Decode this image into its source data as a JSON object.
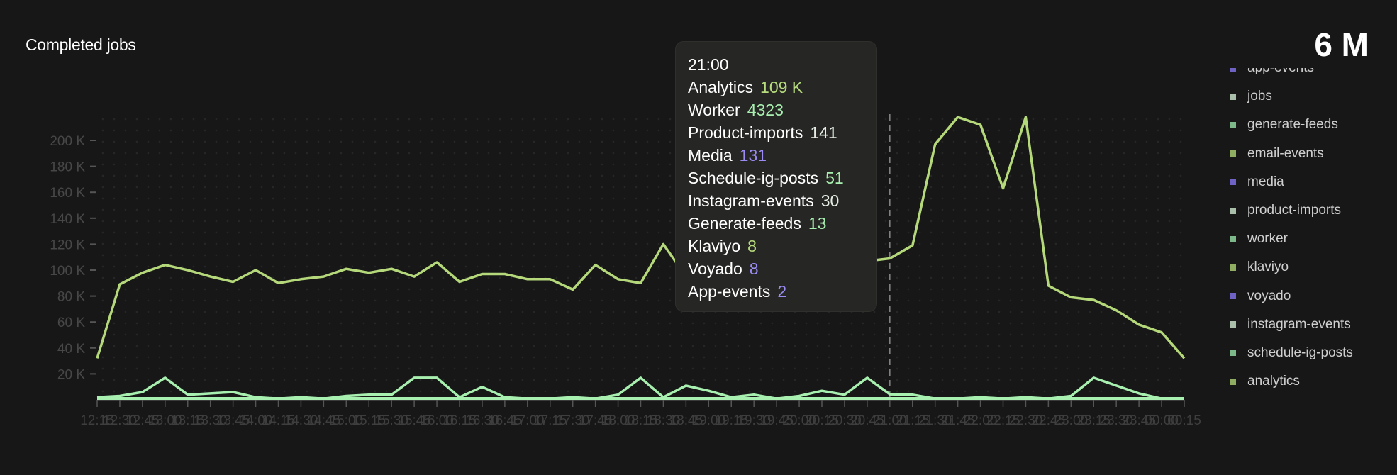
{
  "header": {
    "title": "Completed jobs",
    "total": "6 M"
  },
  "legend": [
    {
      "label": "app-events",
      "color": "#6e63c4"
    },
    {
      "label": "jobs",
      "color": "#a9bfa9"
    },
    {
      "label": "generate-feeds",
      "color": "#7db88a"
    },
    {
      "label": "email-events",
      "color": "#8fae62"
    },
    {
      "label": "media",
      "color": "#6e63c4"
    },
    {
      "label": "product-imports",
      "color": "#a9bfa9"
    },
    {
      "label": "worker",
      "color": "#7db88a"
    },
    {
      "label": "klaviyo",
      "color": "#8fae62"
    },
    {
      "label": "voyado",
      "color": "#6e63c4"
    },
    {
      "label": "instagram-events",
      "color": "#a9bfa9"
    },
    {
      "label": "schedule-ig-posts",
      "color": "#7db88a"
    },
    {
      "label": "analytics",
      "color": "#8fae62"
    }
  ],
  "tooltip": {
    "time": "21:00",
    "rows": [
      {
        "label": "Analytics",
        "value": "109 K",
        "color": "#b7dc7d"
      },
      {
        "label": "Worker",
        "value": "4323",
        "color": "#a8f0b0"
      },
      {
        "label": "Product-imports",
        "value": "141",
        "color": "#e6eee6"
      },
      {
        "label": "Media",
        "value": "131",
        "color": "#9a8cf2"
      },
      {
        "label": "Schedule-ig-posts",
        "value": "51",
        "color": "#a8f0b0"
      },
      {
        "label": "Instagram-events",
        "value": "30",
        "color": "#e6eee6"
      },
      {
        "label": "Generate-feeds",
        "value": "13",
        "color": "#a8f0b0"
      },
      {
        "label": "Klaviyo",
        "value": "8",
        "color": "#b7dc7d"
      },
      {
        "label": "Voyado",
        "value": "8",
        "color": "#9a8cf2"
      },
      {
        "label": "App-events",
        "value": "2",
        "color": "#9a8cf2"
      }
    ]
  },
  "chart_data": {
    "type": "line",
    "title": "Completed jobs",
    "ylim": [
      0,
      200000
    ],
    "yticks": [
      20000,
      40000,
      60000,
      80000,
      100000,
      120000,
      140000,
      160000,
      180000,
      200000
    ],
    "ytick_labels": [
      "20 K",
      "40 K",
      "60 K",
      "80 K",
      "100 K",
      "120 K",
      "140 K",
      "160 K",
      "180 K",
      "200 K"
    ],
    "grid": "dotted background",
    "legend_position": "right",
    "hover_x": "21:00",
    "x": [
      "12:15",
      "12:30",
      "12:45",
      "13:00",
      "13:15",
      "13:30",
      "13:45",
      "14:00",
      "14:15",
      "14:30",
      "14:45",
      "15:00",
      "15:15",
      "15:30",
      "15:45",
      "16:00",
      "16:15",
      "16:30",
      "16:45",
      "17:00",
      "17:15",
      "17:30",
      "17:45",
      "18:00",
      "18:15",
      "18:30",
      "18:45",
      "19:00",
      "19:15",
      "19:30",
      "19:45",
      "20:00",
      "20:15",
      "20:30",
      "20:45",
      "21:00",
      "21:15",
      "21:30",
      "21:45",
      "22:00",
      "22:15",
      "22:30",
      "22:45",
      "23:00",
      "23:15",
      "23:30",
      "23:45",
      "00:00",
      "00:15"
    ],
    "series": [
      {
        "name": "analytics",
        "color": "#b5d97a",
        "values": [
          32000,
          89000,
          98000,
          104000,
          100000,
          95000,
          91000,
          100000,
          90000,
          93000,
          95000,
          101000,
          98000,
          101000,
          95000,
          106000,
          91000,
          97000,
          97000,
          93000,
          93000,
          85000,
          104000,
          93000,
          90000,
          120000,
          95000,
          100000,
          98000,
          102000,
          97000,
          101000,
          99000,
          104000,
          107000,
          109000,
          119000,
          197000,
          218000,
          212000,
          163000,
          218000,
          88000,
          79000,
          77000,
          69000,
          58000,
          52000,
          32000
        ]
      },
      {
        "name": "worker",
        "color": "#a8f0b0",
        "values": [
          2000,
          3000,
          6000,
          17000,
          4000,
          5000,
          6000,
          2000,
          1000,
          2000,
          1000,
          3000,
          4000,
          4000,
          17000,
          17000,
          2000,
          10000,
          2000,
          1000,
          1000,
          2000,
          1000,
          4000,
          17000,
          2000,
          11000,
          7000,
          2000,
          4000,
          1000,
          3000,
          7000,
          4000,
          17000,
          4323,
          4000,
          1000,
          1000,
          2000,
          1000,
          2000,
          1000,
          3000,
          17000,
          11000,
          5000,
          1000,
          1000
        ]
      }
    ]
  }
}
